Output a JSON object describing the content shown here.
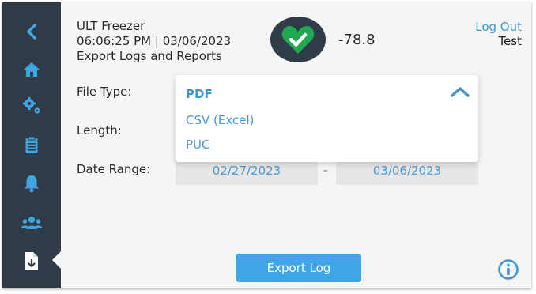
{
  "header": {
    "device_name": "ULT Freezer",
    "datetime": "06:06:25 PM | 03/06/2023",
    "page_title": "Export Logs and Reports",
    "temperature": "-78.8",
    "status_icon": "heart-check-icon",
    "logout_label": "Log Out",
    "user_name": "Test"
  },
  "sidebar": {
    "items": [
      {
        "icon": "back-chevron-icon"
      },
      {
        "icon": "home-icon"
      },
      {
        "icon": "settings-gears-icon"
      },
      {
        "icon": "clipboard-icon"
      },
      {
        "icon": "bell-icon"
      },
      {
        "icon": "users-icon"
      },
      {
        "icon": "export-file-icon",
        "active": true
      }
    ]
  },
  "form": {
    "file_type_label": "File Type:",
    "length_label": "Length:",
    "date_range_label": "Date Range:",
    "date_start": "02/27/2023",
    "date_separator": "–",
    "date_end": "03/06/2023"
  },
  "dropdown": {
    "options": [
      "PDF",
      "CSV (Excel)",
      "PUC"
    ],
    "selected": "PDF"
  },
  "actions": {
    "export_label": "Export Log"
  },
  "colors": {
    "sidebar": "#2f3b47",
    "accent": "#3d97d3",
    "button": "#3ea6e6",
    "status_ok": "#1fa84f"
  }
}
